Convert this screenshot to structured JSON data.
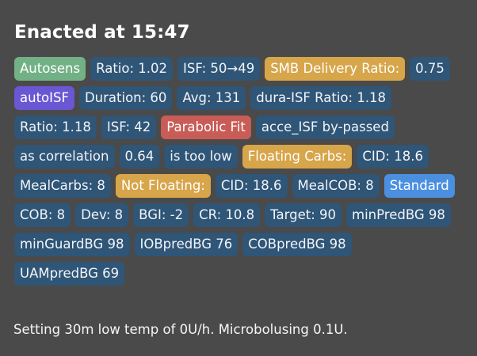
{
  "title": "Enacted at 15:47",
  "tags": [
    {
      "text": "Autosens",
      "color": "#72b186"
    },
    {
      "text": "Ratio: 1.02",
      "color": "#2f5577"
    },
    {
      "text": "ISF: 50→49",
      "color": "#2f5577"
    },
    {
      "text": "SMB Delivery Ratio:",
      "color": "#d7a54a"
    },
    {
      "text": "0.75",
      "color": "#2f5577"
    },
    {
      "text": "autoISF",
      "color": "#6a57d3"
    },
    {
      "text": "Duration: 60",
      "color": "#2f5577"
    },
    {
      "text": "Avg: 131",
      "color": "#2f5577"
    },
    {
      "text": "dura-ISF Ratio: 1.18",
      "color": "#2f5577"
    },
    {
      "text": "Ratio: 1.18",
      "color": "#2f5577"
    },
    {
      "text": "ISF: 42",
      "color": "#2f5577"
    },
    {
      "text": "Parabolic Fit",
      "color": "#c95c57"
    },
    {
      "text": "acce_ISF by-passed",
      "color": "#2f5577"
    },
    {
      "text": "as correlation",
      "color": "#2f5577"
    },
    {
      "text": "0.64",
      "color": "#2f5577"
    },
    {
      "text": "is too low",
      "color": "#2f5577"
    },
    {
      "text": "Floating Carbs:",
      "color": "#d7a54a"
    },
    {
      "text": "CID: 18.6",
      "color": "#2f5577"
    },
    {
      "text": "MealCarbs: 8",
      "color": "#2f5577"
    },
    {
      "text": "Not Floating:",
      "color": "#d7a54a"
    },
    {
      "text": "CID: 18.6",
      "color": "#2f5577"
    },
    {
      "text": "MealCOB: 8",
      "color": "#2f5577"
    },
    {
      "text": "Standard",
      "color": "#4a8fe0"
    },
    {
      "text": "COB: 8",
      "color": "#2f5577"
    },
    {
      "text": "Dev: 8",
      "color": "#2f5577"
    },
    {
      "text": "BGI: -2",
      "color": "#2f5577"
    },
    {
      "text": "CR: 10.8",
      "color": "#2f5577"
    },
    {
      "text": "Target: 90",
      "color": "#2f5577"
    },
    {
      "text": "minPredBG 98",
      "color": "#2f5577"
    },
    {
      "text": "minGuardBG 98",
      "color": "#2f5577"
    },
    {
      "text": "IOBpredBG 76",
      "color": "#2f5577"
    },
    {
      "text": "COBpredBG 98",
      "color": "#2f5577"
    },
    {
      "text": "UAMpredBG 69",
      "color": "#2f5577"
    }
  ],
  "footer": "Setting 30m low temp of 0U/h. Microbolusing 0.1U."
}
